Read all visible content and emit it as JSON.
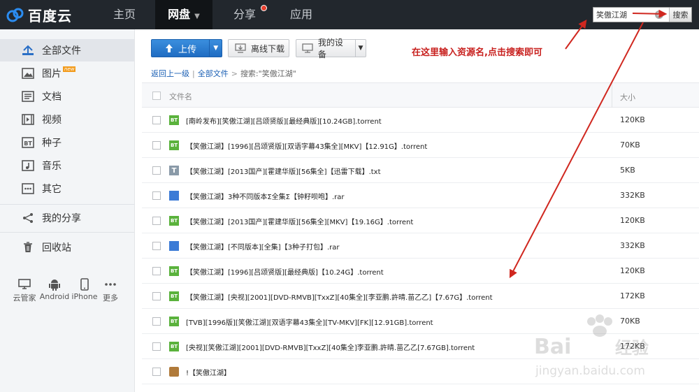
{
  "header": {
    "logo_text": "百度云",
    "nav": [
      {
        "label": "主页"
      },
      {
        "label": "网盘"
      },
      {
        "label": "分享"
      },
      {
        "label": "应用"
      }
    ],
    "search": {
      "value": "笑傲江湖",
      "button_label": "搜索"
    }
  },
  "sidebar": {
    "items": [
      {
        "label": "全部文件",
        "icon": "folder-icon"
      },
      {
        "label": "图片",
        "icon": "image-icon",
        "badge": "new"
      },
      {
        "label": "文档",
        "icon": "document-icon"
      },
      {
        "label": "视频",
        "icon": "video-icon"
      },
      {
        "label": "种子",
        "icon": "bt-icon"
      },
      {
        "label": "音乐",
        "icon": "music-icon"
      },
      {
        "label": "其它",
        "icon": "more-icon"
      },
      {
        "label": "我的分享",
        "icon": "share-icon"
      },
      {
        "label": "回收站",
        "icon": "trash-icon"
      }
    ],
    "devices": [
      {
        "label": "云管家",
        "icon": "monitor-icon"
      },
      {
        "label": "Android",
        "icon": "android-icon"
      },
      {
        "label": "iPhone",
        "icon": "phone-icon"
      },
      {
        "label": "更多",
        "icon": "ellipsis-icon"
      }
    ]
  },
  "toolbar": {
    "upload_label": "上传",
    "offline_label": "离线下载",
    "devices_label": "我的设备"
  },
  "annotation": "在这里输入资源名,点击搜索即可",
  "breadcrumb": {
    "back": "返回上一级",
    "all_files": "全部文件",
    "search_prefix": "搜索:",
    "query": "\"笑傲江湖\""
  },
  "table": {
    "headers": {
      "name": "文件名",
      "size": "大小"
    },
    "rows": [
      {
        "icon": "bt",
        "name": "[南岭发布][笑傲江湖][吕颂贤版][最经典版][10.24GB].torrent",
        "size": "120KB"
      },
      {
        "icon": "bt",
        "name": "【笑傲江湖】[1996][吕颂贤版][双语字幕43集全][MKV]【12.91G】.torrent",
        "size": "70KB"
      },
      {
        "icon": "txt",
        "name": "【笑傲江湖】[2013国产][霍建华版][56集全]【迅雷下载】.txt",
        "size": "5KB"
      },
      {
        "icon": "rar",
        "name": "【笑傲江湖】3种不同版本Σ全集Σ【钟籽呗咆】.rar",
        "size": "332KB"
      },
      {
        "icon": "bt",
        "name": "【笑傲江湖】[2013国产][霍建华版][56集全][MKV]【19.16G】.torrent",
        "size": "120KB"
      },
      {
        "icon": "rar",
        "name": "【笑傲江湖】[不同版本][全集]【3种子打包】.rar",
        "size": "332KB"
      },
      {
        "icon": "bt",
        "name": "【笑傲江湖】[1996][吕颂贤版][最经典版]【10.24G】.torrent",
        "size": "120KB"
      },
      {
        "icon": "bt",
        "name": "【笑傲江湖】[央视][2001][DVD-RMVB][TxxZ][40集全][李亚鹏.許晴.苗乙乙]【7.67G】.torrent",
        "size": "172KB"
      },
      {
        "icon": "bt",
        "name": "[TVB][1996版][笑傲江湖][双语字幕43集全][TV-MKV][FK][12.91GB].torrent",
        "size": "70KB"
      },
      {
        "icon": "bt",
        "name": "[央视][笑傲江湖][2001][DVD-RMVB][TxxZ][40集全]李亚鹏.許晴.苗乙乙[7.67GB].torrent",
        "size": "172KB"
      },
      {
        "icon": "folder",
        "name": "!【笑傲江湖】",
        "size": ""
      }
    ]
  },
  "watermark": {
    "brand": "Baidu经验",
    "url": "jingyan.baidu.com"
  },
  "colors": {
    "accent": "#1f6cc2",
    "annotation": "#c8201e",
    "topbar": "#22272d"
  }
}
